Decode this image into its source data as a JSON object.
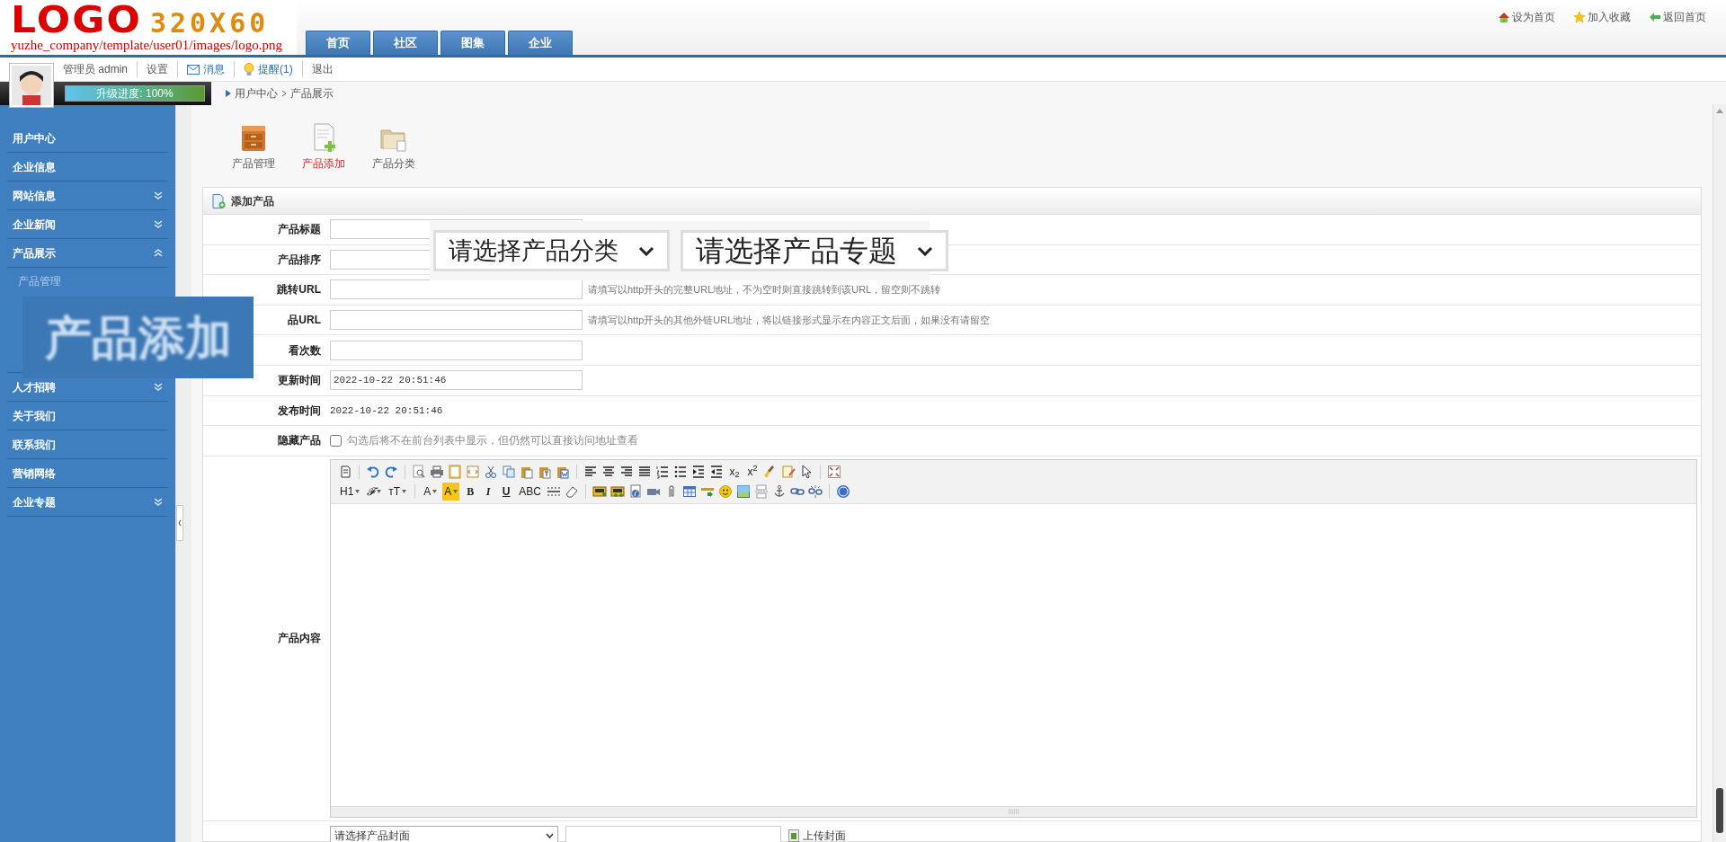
{
  "logo": {
    "text": "LOGO",
    "size": "320X60",
    "path": "yuzhe_company/template/user01/images/logo.png"
  },
  "nav_tabs": [
    "首页",
    "社区",
    "图集",
    "企业"
  ],
  "top_links": [
    "设为首页",
    "加入收藏",
    "返回首页"
  ],
  "user_bar": {
    "user": "管理员 admin",
    "links": [
      {
        "label": "设置",
        "kind": "plain"
      },
      {
        "label": "消息",
        "kind": "mail"
      },
      {
        "label": "提醒(1)",
        "kind": "bulb"
      },
      {
        "label": "退出",
        "kind": "plain"
      }
    ],
    "progress": {
      "label": "升级进度: 100%",
      "level": 1
    }
  },
  "breadcrumb": [
    "用户中心",
    "产品展示"
  ],
  "sidebar": {
    "items": [
      {
        "label": "用户中心",
        "expandable": false
      },
      {
        "label": "企业信息",
        "expandable": false
      },
      {
        "label": "网站信息",
        "expandable": true,
        "expanded": false
      },
      {
        "label": "企业新闻",
        "expandable": true,
        "expanded": false
      },
      {
        "label": "产品展示",
        "expandable": true,
        "expanded": true,
        "children": [
          {
            "label": "产品管理"
          }
        ]
      },
      {
        "label": "人才招聘",
        "expandable": true,
        "expanded": false
      },
      {
        "label": "关于我们",
        "expandable": false
      },
      {
        "label": "联系我们",
        "expandable": false
      },
      {
        "label": "营销网络",
        "expandable": false
      },
      {
        "label": "企业专题",
        "expandable": true,
        "expanded": false
      }
    ]
  },
  "module_tools": [
    {
      "label": "产品管理",
      "selected": false
    },
    {
      "label": "产品添加",
      "selected": true
    },
    {
      "label": "产品分类",
      "selected": false
    }
  ],
  "form": {
    "title": "添加产品",
    "rows": [
      {
        "kind": "input",
        "label": "产品标题"
      },
      {
        "kind": "input",
        "label": "产品排序"
      },
      {
        "kind": "input",
        "label": "跳转URL",
        "hint": "请填写以http开头的完整URL地址，不为空时则直接跳转到该URL，留空则不跳转"
      },
      {
        "kind": "input",
        "label": "品URL",
        "hint": "请填写以http开头的其他外链URL地址，将以链接形式显示在内容正文后面，如果没有请留空"
      },
      {
        "kind": "input",
        "label": "看次数"
      },
      {
        "kind": "input",
        "label": "更新时间",
        "value": "2022-10-22 20:51:46"
      },
      {
        "kind": "text",
        "label": "发布时间",
        "value": "2022-10-22 20:51:46"
      },
      {
        "kind": "checkbox",
        "label": "隐藏产品",
        "checked": false,
        "hint": "勾选后将不在前台列表中显示，但仍然可以直接访问地址查看"
      },
      {
        "kind": "editor",
        "label": "产品内容"
      },
      {
        "kind": "cover",
        "select": "请选择产品封面",
        "button": "上传封面"
      }
    ]
  },
  "editor_toolbar_texts": [
    "x$_{2}$",
    "x$^{2}$",
    "H1",
    "𝓕",
    "тT",
    "A",
    "A",
    "B",
    "I",
    "U",
    "ABC"
  ],
  "zoom_overlay": {
    "dropdowns": [
      "请选择产品分类",
      "请选择产品专题"
    ]
  },
  "tooltip_overlay": "产品添加"
}
